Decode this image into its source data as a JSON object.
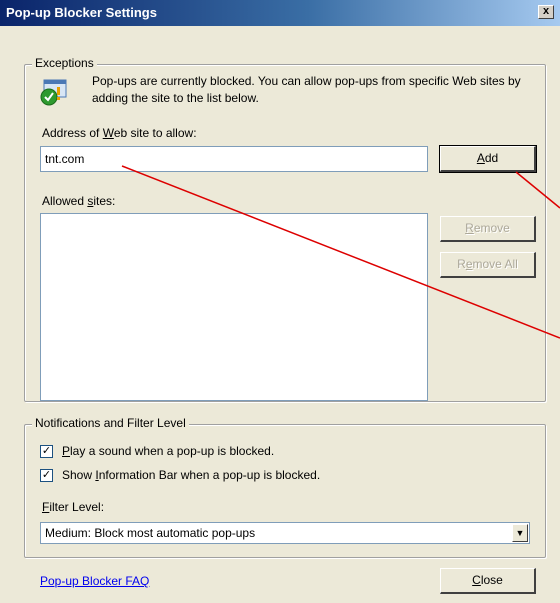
{
  "window": {
    "title": "Pop-up Blocker Settings",
    "close_label": "x"
  },
  "exceptions": {
    "legend": "Exceptions",
    "info_text": "Pop-ups are currently blocked.  You can allow pop-ups from specific Web sites by adding the site to the list below.",
    "address_label_pre": "Address of ",
    "address_label_mnemonic": "W",
    "address_label_post": "eb site to allow:",
    "address_value": "tnt.com",
    "add_button": {
      "mnemonic": "A",
      "rest": "dd"
    },
    "allowed_label_pre": "Allowed ",
    "allowed_label_mnemonic": "s",
    "allowed_label_post": "ites:",
    "allowed_sites": [],
    "remove_button": {
      "mnemonic": "R",
      "rest": "emove"
    },
    "remove_all_button": {
      "pre": "R",
      "mnemonic": "e",
      "rest": "move All"
    }
  },
  "notifications": {
    "legend": "Notifications and Filter Level",
    "play_sound": {
      "mnemonic": "P",
      "rest": "lay a sound when a pop-up is blocked.",
      "checked": true
    },
    "show_infobar": {
      "pre": "Show ",
      "mnemonic": "I",
      "rest": "nformation Bar when a pop-up is blocked.",
      "checked": true
    },
    "filter_label": {
      "mnemonic": "F",
      "rest": "ilter Level:"
    },
    "filter_value": "Medium: Block most automatic pop-ups"
  },
  "footer": {
    "faq_link": "Pop-up Blocker FAQ",
    "close_button": {
      "mnemonic": "C",
      "rest": "lose"
    }
  },
  "colors": {
    "title_gradient_start": "#0a246a",
    "title_gradient_end": "#a6caf0",
    "dialog_bg": "#ece9d8",
    "annotation_line": "#dd0000",
    "link": "#0000ee"
  }
}
